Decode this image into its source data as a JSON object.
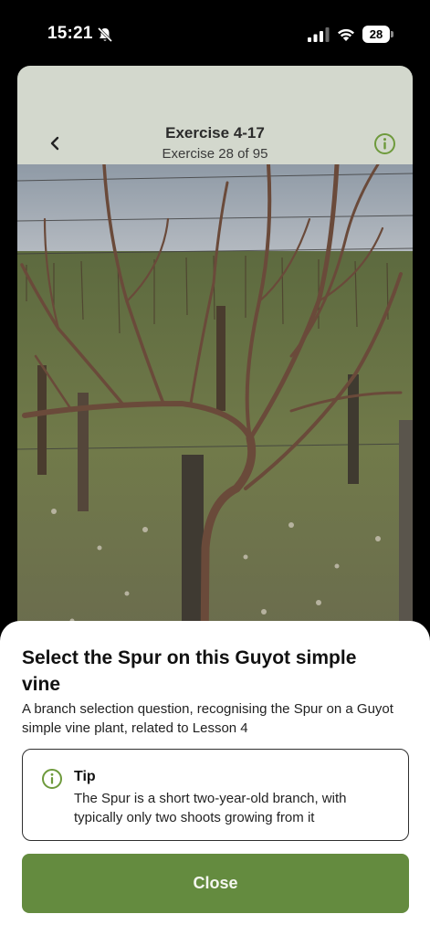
{
  "status_bar": {
    "time": "15:21",
    "battery_level": "28",
    "icons": [
      "bell-slash-icon",
      "signal-icon",
      "wifi-icon",
      "battery-icon"
    ]
  },
  "exercise": {
    "title": "Exercise 4-17",
    "progress": "Exercise 28 of 95",
    "icons": [
      "chevron-left-icon",
      "info-icon"
    ],
    "image": "Guyot simple vine in a vineyard"
  },
  "sheet": {
    "title": "Select the Spur on this Guyot simple vine",
    "description": "A branch selection question, recognising the Spur on a Guyot simple vine plant, related to Lesson 4",
    "tip": {
      "icon": "info-icon",
      "title": "Tip",
      "text": "The Spur is a short two-year-old branch, with typically only two shoots growing from it"
    },
    "close_label": "Close"
  },
  "colors": {
    "accent_green": "#648b3f",
    "info_icon_green": "#6e9a3c",
    "card_background": "#d3d8cd"
  }
}
